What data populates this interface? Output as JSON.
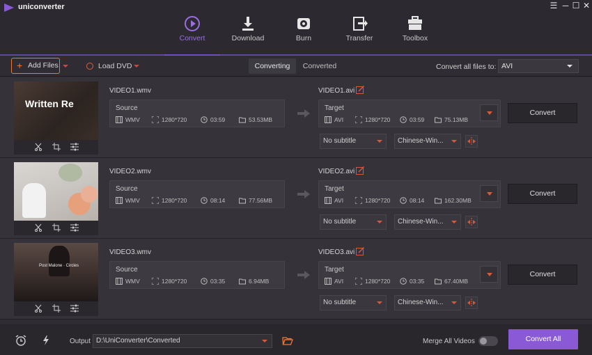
{
  "app": {
    "name": "uniconverter",
    "accent": "#8a5ad6"
  },
  "window_controls": [
    "☰",
    "─",
    "☐",
    "✕"
  ],
  "nav": {
    "tabs": [
      {
        "label": "Convert",
        "icon": "convert-icon",
        "active": true
      },
      {
        "label": "Download",
        "icon": "download-icon"
      },
      {
        "label": "Burn",
        "icon": "burn-icon"
      },
      {
        "label": "Transfer",
        "icon": "transfer-icon"
      },
      {
        "label": "Toolbox",
        "icon": "toolbox-icon"
      }
    ]
  },
  "toolbar": {
    "add_files": "Add Files",
    "load_dvd": "Load DVD",
    "tab_converting": "Converting",
    "tab_converted": "Converted",
    "convert_all_to": "Convert all files to:",
    "format": "AVI"
  },
  "items": [
    {
      "thumb_caption": "Written Re",
      "source_name": "VIDEO1.wmv",
      "source_label": "Source",
      "src_fmt": "WMV",
      "src_res": "1280*720",
      "src_dur": "03:59",
      "src_size": "53.53MB",
      "target_name": "VIDEO1.avi",
      "target_label": "Target",
      "tgt_fmt": "AVI",
      "tgt_res": "1280*720",
      "tgt_dur": "03:59",
      "tgt_size": "75.13MB",
      "subtitle": "No subtitle",
      "audio": "Chinese-Win...",
      "convert": "Convert"
    },
    {
      "thumb_caption": "",
      "source_name": "VIDEO2.wmv",
      "source_label": "Source",
      "src_fmt": "WMV",
      "src_res": "1280*720",
      "src_dur": "08:14",
      "src_size": "77.56MB",
      "target_name": "VIDEO2.avi",
      "target_label": "Target",
      "tgt_fmt": "AVI",
      "tgt_res": "1280*720",
      "tgt_dur": "08:14",
      "tgt_size": "162.30MB",
      "subtitle": "No subtitle",
      "audio": "Chinese-Win...",
      "convert": "Convert"
    },
    {
      "thumb_caption": "Post Malone · Circles",
      "source_name": "VIDEO3.wmv",
      "source_label": "Source",
      "src_fmt": "WMV",
      "src_res": "1280*720",
      "src_dur": "03:35",
      "src_size": "6.94MB",
      "target_name": "VIDEO3.avi",
      "target_label": "Target",
      "tgt_fmt": "AVI",
      "tgt_res": "1280*720",
      "tgt_dur": "03:35",
      "tgt_size": "67.40MB",
      "subtitle": "No subtitle",
      "audio": "Chinese-Win...",
      "convert": "Convert"
    }
  ],
  "bottom": {
    "output_label": "Output",
    "output_path": "D:\\UniConverter\\Converted",
    "merge_label": "Merge All Videos",
    "merge_on": false,
    "convert_all": "Convert All"
  }
}
